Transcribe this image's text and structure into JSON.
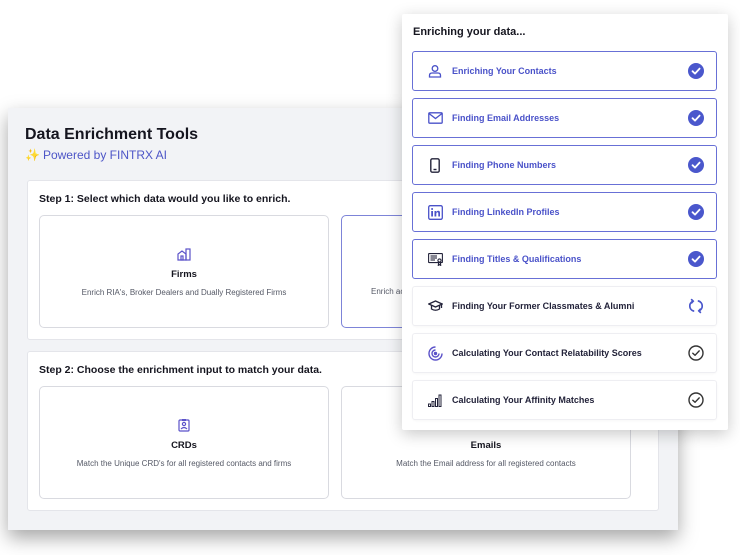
{
  "back": {
    "title": "Data Enrichment Tools",
    "powered": "Powered by FINTRX AI",
    "step1": {
      "title": "Step 1: Select which data would you like to enrich.",
      "options": [
        {
          "title": "Firms",
          "desc": "Enrich RIA's, Broker Dealers and Dually Registered Firms",
          "icon": "building-icon"
        },
        {
          "title": "",
          "desc": "Enrich ac",
          "icon": ""
        }
      ]
    },
    "step2": {
      "title": "Step 2: Choose the enrichment input to match your data.",
      "options": [
        {
          "title": "CRDs",
          "desc": "Match the Unique CRD's for all registered contacts and firms",
          "icon": "id-badge-icon"
        },
        {
          "title": "Emails",
          "desc": "Match the Email address for all registered contacts",
          "icon": "envelope-icon"
        }
      ]
    }
  },
  "front": {
    "title": "Enriching your data...",
    "tasks": [
      {
        "label": "Enriching Your Contacts",
        "icon": "person-icon",
        "status": "done"
      },
      {
        "label": "Finding Email Addresses",
        "icon": "envelope-icon",
        "status": "done"
      },
      {
        "label": "Finding Phone Numbers",
        "icon": "phone-icon",
        "status": "done"
      },
      {
        "label": "Finding LinkedIn Profiles",
        "icon": "linkedin-icon",
        "status": "done"
      },
      {
        "label": "Finding Titles & Qualifications",
        "icon": "certificate-icon",
        "status": "done"
      },
      {
        "label": "Finding Your Former Classmates & Alumni",
        "icon": "graduation-cap-icon",
        "status": "in-progress"
      },
      {
        "label": "Calculating Your Contact Relatability Scores",
        "icon": "target-icon",
        "status": "pending"
      },
      {
        "label": "Calculating Your Affinity Matches",
        "icon": "signal-bars-icon",
        "status": "pending"
      }
    ]
  },
  "colors": {
    "accent": "#4a52c9",
    "done_border": "#6870d6",
    "check_fill": "#4a57cc"
  }
}
